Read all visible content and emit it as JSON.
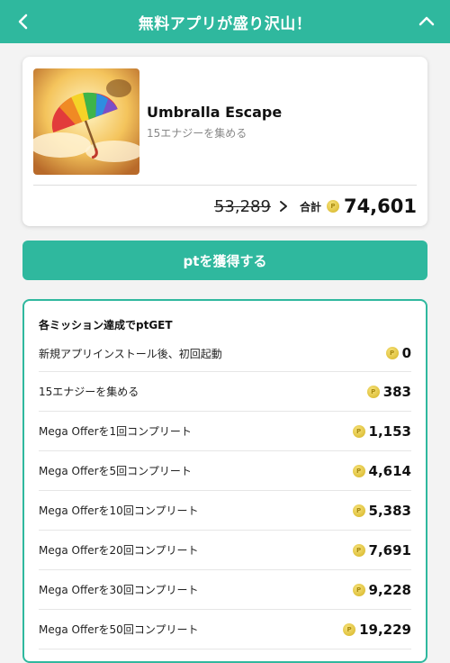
{
  "header": {
    "title": "無料アプリが盛り沢山！",
    "back_icon": "chevron-left-icon",
    "collapse_icon": "chevron-up-icon",
    "background": "#2fb89e"
  },
  "app": {
    "name": "Umbralla Escape",
    "subtitle": "15エナジーを集める",
    "thumbnail": "umbrella-game-thumbnail",
    "old_points": "53,289",
    "total_label": "合計",
    "total_points": "74,601",
    "coin_icon": "point-coin-icon"
  },
  "cta": {
    "label": "ptを獲得する"
  },
  "missions": {
    "title": "各ミッション達成でptGET",
    "items": [
      {
        "label": "新規アプリインストール後、初回起動",
        "points": "0"
      },
      {
        "label": "15エナジーを集める",
        "points": "383"
      },
      {
        "label": "Mega Offerを1回コンプリート",
        "points": "1,153"
      },
      {
        "label": "Mega Offerを5回コンプリート",
        "points": "4,614"
      },
      {
        "label": "Mega Offerを10回コンプリート",
        "points": "5,383"
      },
      {
        "label": "Mega Offerを20回コンプリート",
        "points": "7,691"
      },
      {
        "label": "Mega Offerを30回コンプリート",
        "points": "9,228"
      },
      {
        "label": "Mega Offerを50回コンプリート",
        "points": "19,229"
      }
    ]
  }
}
